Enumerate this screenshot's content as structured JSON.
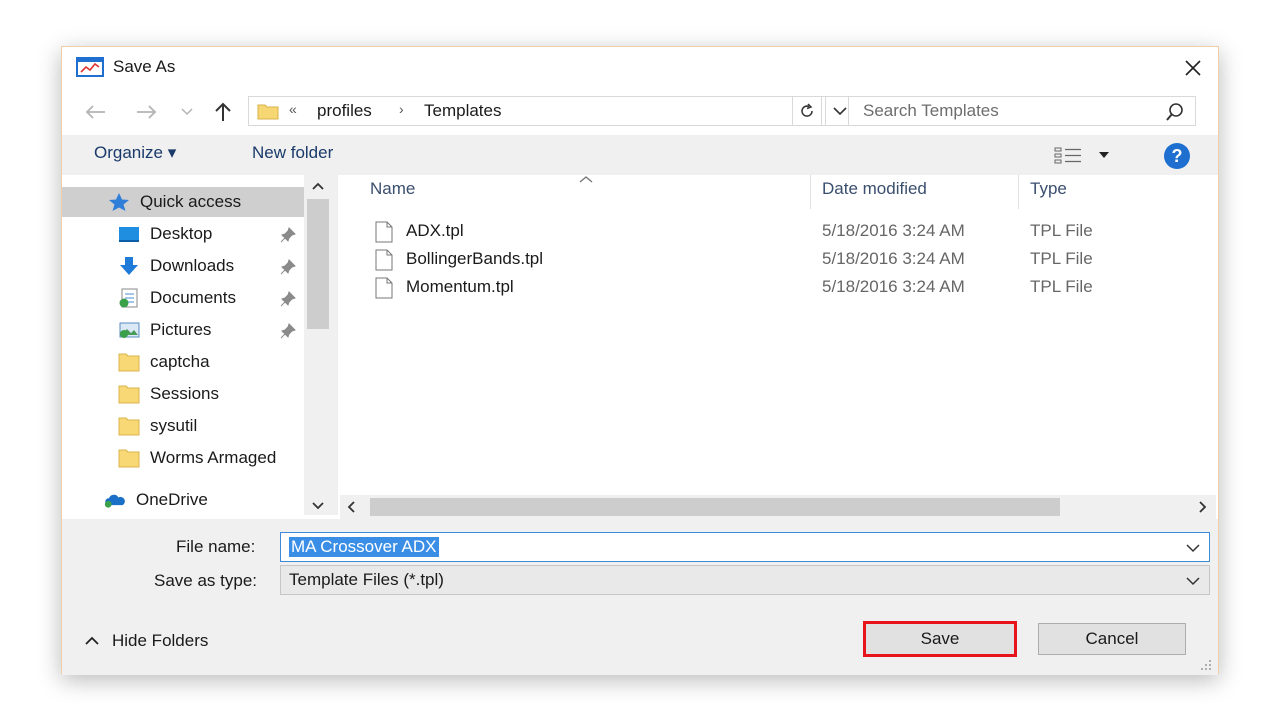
{
  "window": {
    "title": "Save As",
    "close_icon": "close-icon"
  },
  "address": {
    "prefix": "«",
    "crumbs": [
      "profiles",
      "Templates"
    ],
    "separator": "›",
    "search_placeholder": "Search Templates"
  },
  "toolbar": {
    "organize_label": "Organize ▾",
    "new_folder_label": "New folder",
    "help_label": "?"
  },
  "nav": {
    "quick_access": "Quick access",
    "items": [
      {
        "label": "Desktop",
        "icon": "desktop-icon",
        "pinned": true
      },
      {
        "label": "Downloads",
        "icon": "download-icon",
        "pinned": true
      },
      {
        "label": "Documents",
        "icon": "documents-icon",
        "pinned": true
      },
      {
        "label": "Pictures",
        "icon": "pictures-icon",
        "pinned": true
      },
      {
        "label": "captcha",
        "icon": "folder-icon",
        "pinned": false
      },
      {
        "label": "Sessions",
        "icon": "folder-icon",
        "pinned": false
      },
      {
        "label": "sysutil",
        "icon": "folder-icon",
        "pinned": false
      },
      {
        "label": "Worms Armaged",
        "icon": "folder-icon",
        "pinned": false
      }
    ],
    "onedrive": "OneDrive"
  },
  "file_list": {
    "columns": {
      "name": "Name",
      "date": "Date modified",
      "type": "Type"
    },
    "files": [
      {
        "name": "ADX.tpl",
        "date": "5/18/2016 3:24 AM",
        "type": "TPL File"
      },
      {
        "name": "BollingerBands.tpl",
        "date": "5/18/2016 3:24 AM",
        "type": "TPL File"
      },
      {
        "name": "Momentum.tpl",
        "date": "5/18/2016 3:24 AM",
        "type": "TPL File"
      }
    ]
  },
  "form": {
    "file_name_label": "File name:",
    "file_name_value": "MA Crossover ADX",
    "save_type_label": "Save as type:",
    "save_type_value": "Template Files (*.tpl)"
  },
  "footer": {
    "hide_folders_label": "Hide Folders",
    "save_label": "Save",
    "cancel_label": "Cancel"
  },
  "colors": {
    "accent": "#1e6fd0",
    "highlight": "#e8141b",
    "selection": "#3a8ee6"
  }
}
